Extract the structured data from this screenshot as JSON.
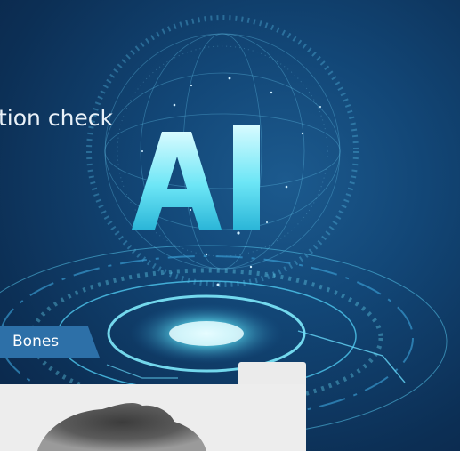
{
  "header": {
    "title": "tion check"
  },
  "tabs": [
    {
      "label": "Bones"
    }
  ],
  "hero": {
    "badge_text": "AI"
  },
  "colors": {
    "background": "#124676",
    "accent": "#5fe3f5",
    "tab": "#2d70a8",
    "panel": "#ededed"
  }
}
